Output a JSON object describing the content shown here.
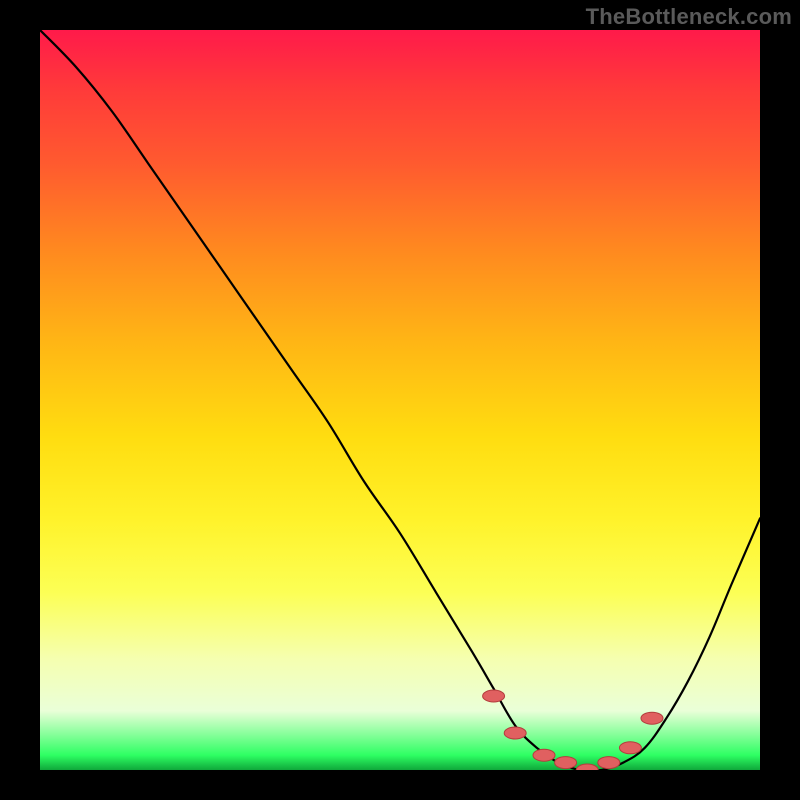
{
  "watermark": "TheBottleneck.com",
  "colors": {
    "background": "#000000",
    "watermark": "#5a5a5a",
    "curve": "#000000",
    "markers_fill": "#e06060",
    "markers_stroke": "#b33d3d",
    "gradient_stops": [
      {
        "offset": 0.0,
        "color": "#ff1a4a"
      },
      {
        "offset": 0.08,
        "color": "#ff3a3a"
      },
      {
        "offset": 0.18,
        "color": "#ff5a2f"
      },
      {
        "offset": 0.3,
        "color": "#ff8a1f"
      },
      {
        "offset": 0.42,
        "color": "#ffb515"
      },
      {
        "offset": 0.55,
        "color": "#ffdd10"
      },
      {
        "offset": 0.66,
        "color": "#fff22a"
      },
      {
        "offset": 0.76,
        "color": "#fcff55"
      },
      {
        "offset": 0.85,
        "color": "#f5ffb0"
      },
      {
        "offset": 0.92,
        "color": "#eaffd8"
      },
      {
        "offset": 0.98,
        "color": "#2eff63"
      },
      {
        "offset": 1.0,
        "color": "#0fa83a"
      }
    ]
  },
  "chart_data": {
    "type": "line",
    "title": "",
    "xlabel": "",
    "ylabel": "",
    "xlim": [
      0,
      100
    ],
    "ylim": [
      0,
      100
    ],
    "note": "Axes are unlabeled in the image; x and y are normalized 0–100. y=0 is the green minimum band at the bottom; y=100 is the top of the gradient.",
    "series": [
      {
        "name": "bottleneck-curve",
        "x": [
          0,
          5,
          10,
          15,
          20,
          25,
          30,
          35,
          40,
          45,
          50,
          55,
          60,
          63,
          66,
          69,
          72,
          75,
          78,
          81,
          84,
          87,
          90,
          93,
          96,
          100
        ],
        "y": [
          100,
          95,
          89,
          82,
          75,
          68,
          61,
          54,
          47,
          39,
          32,
          24,
          16,
          11,
          6,
          3,
          1,
          0,
          0,
          1,
          3,
          7,
          12,
          18,
          25,
          34
        ]
      }
    ],
    "markers": {
      "name": "optimal-range-markers",
      "x": [
        63,
        66,
        70,
        73,
        76,
        79,
        82,
        85
      ],
      "y": [
        10,
        5,
        2,
        1,
        0,
        1,
        3,
        7
      ]
    }
  }
}
